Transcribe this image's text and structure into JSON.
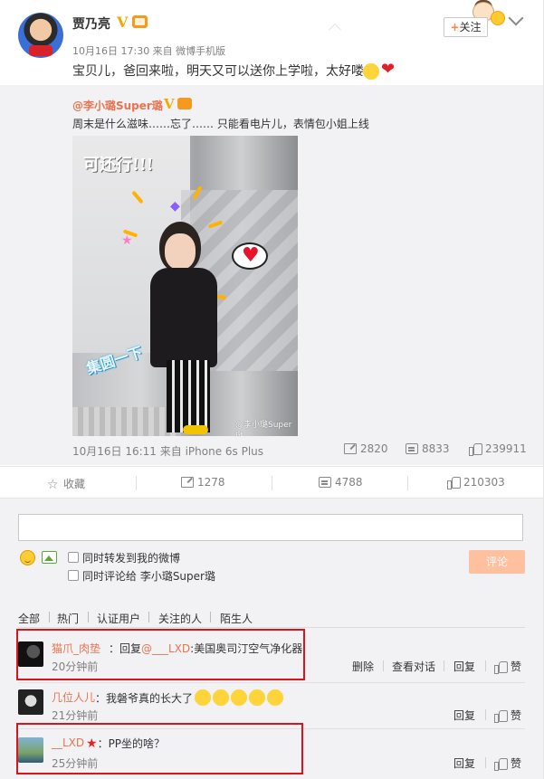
{
  "post": {
    "author": "贾乃亮",
    "verified_mark": "V",
    "meta": "10月16日 17:30 来自 微博手机版",
    "text": "宝贝儿，爸回来啦，明天又可以送你上学啦，太好喽",
    "follow_plus": "+",
    "follow_label": "关注"
  },
  "repost": {
    "author": "@李小璐Super璐",
    "verified_mark": "V",
    "text": "周末是什么滋味……忘了…… 只能看电片儿，表情包小姐上线",
    "photo_sticker_text": "可还行!!!",
    "photo_sticker_text2": "集圆一下",
    "photo_watermark": "@李小璐Super璐",
    "meta": "10月16日 16:11 来自 iPhone 6s Plus",
    "reposts": "2820",
    "comments": "8833",
    "likes": "239911"
  },
  "actions": {
    "favorite_label": "收藏",
    "reposts": "1278",
    "comments": "4788",
    "likes": "210303"
  },
  "composer": {
    "input_value": "",
    "option_repost_label": "同时转发到我的微博",
    "option_comment_label": "同时评论给 李小璐Super璐",
    "submit_label": "评论"
  },
  "filter_tabs": [
    "全部",
    "热门",
    "认证用户",
    "关注的人",
    "陌生人"
  ],
  "comments": [
    {
      "name": "猫爪_肉垫",
      "text": "：回复",
      "mention": "@___LXD",
      "text2": ":美国奥司汀空气净化器",
      "time": "20分钟前",
      "actions": [
        "删除",
        "查看对话",
        "回复",
        "赞"
      ]
    },
    {
      "name": "几位人儿",
      "text": "：我磐爷真的长大了",
      "time": "21分钟前",
      "actions": [
        "回复",
        "赞"
      ]
    },
    {
      "name": "__LXD",
      "star": "★",
      "text": "：PP坐的啥？",
      "time": "25分钟前",
      "actions": [
        "回复",
        "赞"
      ]
    }
  ],
  "colors": {
    "link": "#eb7350",
    "highlight_box": "#d9141d",
    "submit_bg": "#ffc09f",
    "panel_bg": "#f2f2f5"
  }
}
